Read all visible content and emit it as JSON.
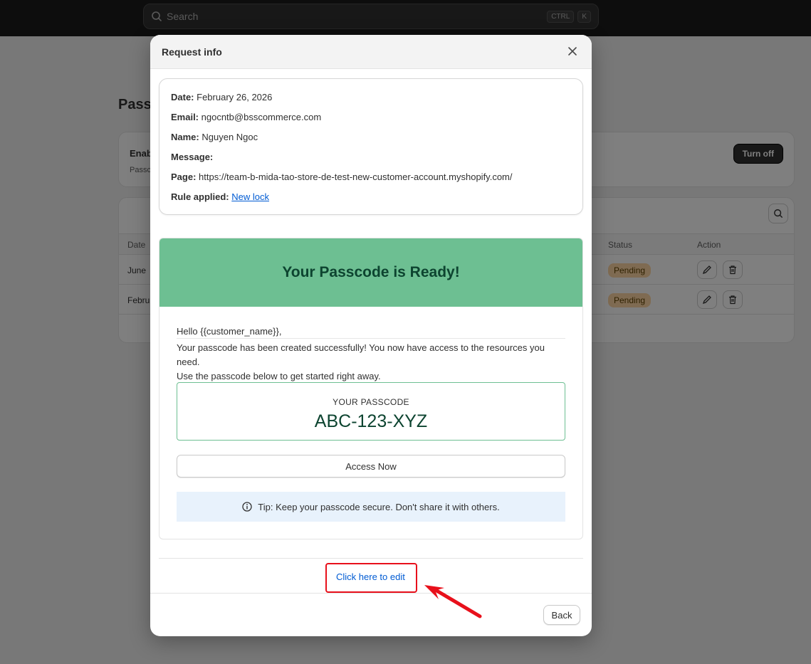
{
  "search": {
    "label": "Search",
    "kbd1": "CTRL",
    "kbd2": "K"
  },
  "background": {
    "page_title": "Passc",
    "enable_title": "Enab",
    "enable_sub": "Passc",
    "turn_off": "Turn off",
    "table": {
      "headers": {
        "date": "Date",
        "status": "Status",
        "action": "Action"
      },
      "rows": [
        {
          "date": "June",
          "status": "Pending"
        },
        {
          "date": "Febru",
          "status": "Pending"
        }
      ]
    }
  },
  "modal": {
    "title": "Request info",
    "info": {
      "date_label": "Date:",
      "date_value": "February 26, 2026",
      "email_label": "Email:",
      "email_value": "ngocntb@bsscommerce.com",
      "name_label": "Name:",
      "name_value": "Nguyen Ngoc",
      "message_label": "Message:",
      "message_value": "",
      "page_label": "Page:",
      "page_value": "https://team-b-mida-tao-store-de-test-new-customer-account.myshopify.com/",
      "rule_label": "Rule applied:",
      "rule_value": "New lock"
    },
    "preview": {
      "heading": "Your Passcode is Ready!",
      "hello": "Hello {{customer_name}},",
      "line1": "Your passcode has been created successfully! You now have access to the resources you need.",
      "line2": "Use the passcode below to get started right away.",
      "passcode_label": "YOUR PASSCODE",
      "passcode_value": "ABC-123-XYZ",
      "access_button": "Access Now",
      "tip": "Tip: Keep your passcode secure. Don't share it with others."
    },
    "edit_link": "Click here to edit",
    "back_button": "Back"
  },
  "colors": {
    "banner": "#6dbf92",
    "heading": "#0d4430",
    "link": "#005bd3",
    "highlight": "#e8101b"
  }
}
